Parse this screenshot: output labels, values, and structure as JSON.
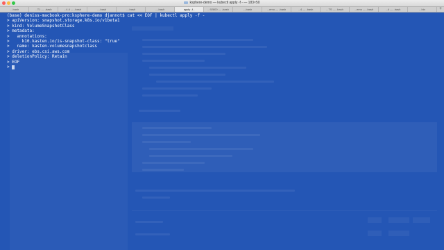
{
  "window": {
    "title": "ksphere-demo — kubectl apply -f - — 183×50",
    "traffic_lights": {
      "close": "#fc605c",
      "minimize": "#fdbc40",
      "zoom": "#34c84a"
    }
  },
  "tabs": [
    {
      "label": "...-bash"
    },
    {
      "label": "...T1 — -bash"
    },
    {
      "label": "...4.4 — -bash"
    },
    {
      "label": "...-bash"
    },
    {
      "label": "...-bash"
    },
    {
      "label": "...-bash"
    },
    {
      "label": "apply -f -",
      "active": true
    },
    {
      "label": "...92800 — -bash"
    },
    {
      "label": "...-bash"
    },
    {
      "label": "...emo — -bash"
    },
    {
      "label": "...4 — -bash"
    },
    {
      "label": "...TS — -bash"
    },
    {
      "label": "...emo — -bash"
    },
    {
      "label": "...4 — -bash"
    },
    {
      "label": "...bin"
    }
  ],
  "terminal": {
    "lines": [
      "(base) deniss-macbook-pro:ksphere-demo djannot$ cat << EOF | kubectl apply -f -",
      "> apiVersion: snapshot.storage.k8s.io/v1beta1",
      "> kind: VolumeSnapshotClass",
      "> metadata:",
      ">   annotations:",
      ">     k10.kasten.io/is-snapshot-class: \"true\"",
      ">   name: kasten-volumesnapshotclass",
      "> driver: ebs.csi.aws.com",
      "> deletionPolicy: Retain",
      "> EOF",
      "> "
    ]
  },
  "colors": {
    "background": "#2456b5",
    "text": "#ffffff"
  }
}
